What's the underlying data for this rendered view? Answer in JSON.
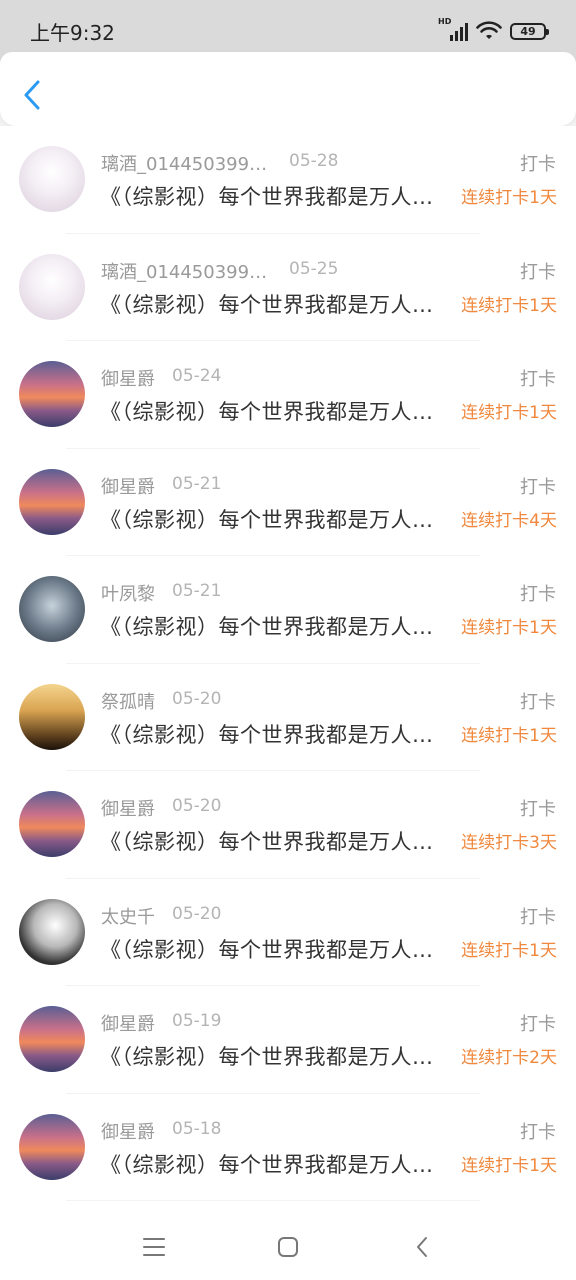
{
  "status_bar": {
    "time": "上午9:32",
    "battery": "49",
    "hd": "HD"
  },
  "header": {
    "back_icon": "chevron-left-icon"
  },
  "items": [
    {
      "name": "璃酒_0144503991...",
      "date": "05-28",
      "title": "《（综影视）每个世界我都是万人迷》",
      "tag": "打卡",
      "streak": "连续打卡1天",
      "avatar": "anime"
    },
    {
      "name": "璃酒_0144503991...",
      "date": "05-25",
      "title": "《（综影视）每个世界我都是万人迷》",
      "tag": "打卡",
      "streak": "连续打卡1天",
      "avatar": "anime"
    },
    {
      "name": "御星爵",
      "date": "05-24",
      "title": "《（综影视）每个世界我都是万人迷》",
      "tag": "打卡",
      "streak": "连续打卡1天",
      "avatar": "sunset"
    },
    {
      "name": "御星爵",
      "date": "05-21",
      "title": "《（综影视）每个世界我都是万人迷》",
      "tag": "打卡",
      "streak": "连续打卡4天",
      "avatar": "sunset"
    },
    {
      "name": "叶夙黎",
      "date": "05-21",
      "title": "《（综影视）每个世界我都是万人迷》",
      "tag": "打卡",
      "streak": "连续打卡1天",
      "avatar": "portrait"
    },
    {
      "name": "祭孤晴",
      "date": "05-20",
      "title": "《（综影视）每个世界我都是万人迷》",
      "tag": "打卡",
      "streak": "连续打卡1天",
      "avatar": "silhouette"
    },
    {
      "name": "御星爵",
      "date": "05-20",
      "title": "《（综影视）每个世界我都是万人迷》",
      "tag": "打卡",
      "streak": "连续打卡3天",
      "avatar": "sunset"
    },
    {
      "name": "太史千",
      "date": "05-20",
      "title": "《（综影视）每个世界我都是万人迷》",
      "tag": "打卡",
      "streak": "连续打卡1天",
      "avatar": "mono"
    },
    {
      "name": "御星爵",
      "date": "05-19",
      "title": "《（综影视）每个世界我都是万人迷》",
      "tag": "打卡",
      "streak": "连续打卡2天",
      "avatar": "sunset"
    },
    {
      "name": "御星爵",
      "date": "05-18",
      "title": "《（综影视）每个世界我都是万人迷》",
      "tag": "打卡",
      "streak": "连续打卡1天",
      "avatar": "sunset"
    }
  ],
  "nav": {
    "menu_icon": "menu-icon",
    "home_icon": "home-icon",
    "back_icon": "back-icon"
  },
  "colors": {
    "accent": "#2b9af3",
    "streak": "#f0883e"
  }
}
